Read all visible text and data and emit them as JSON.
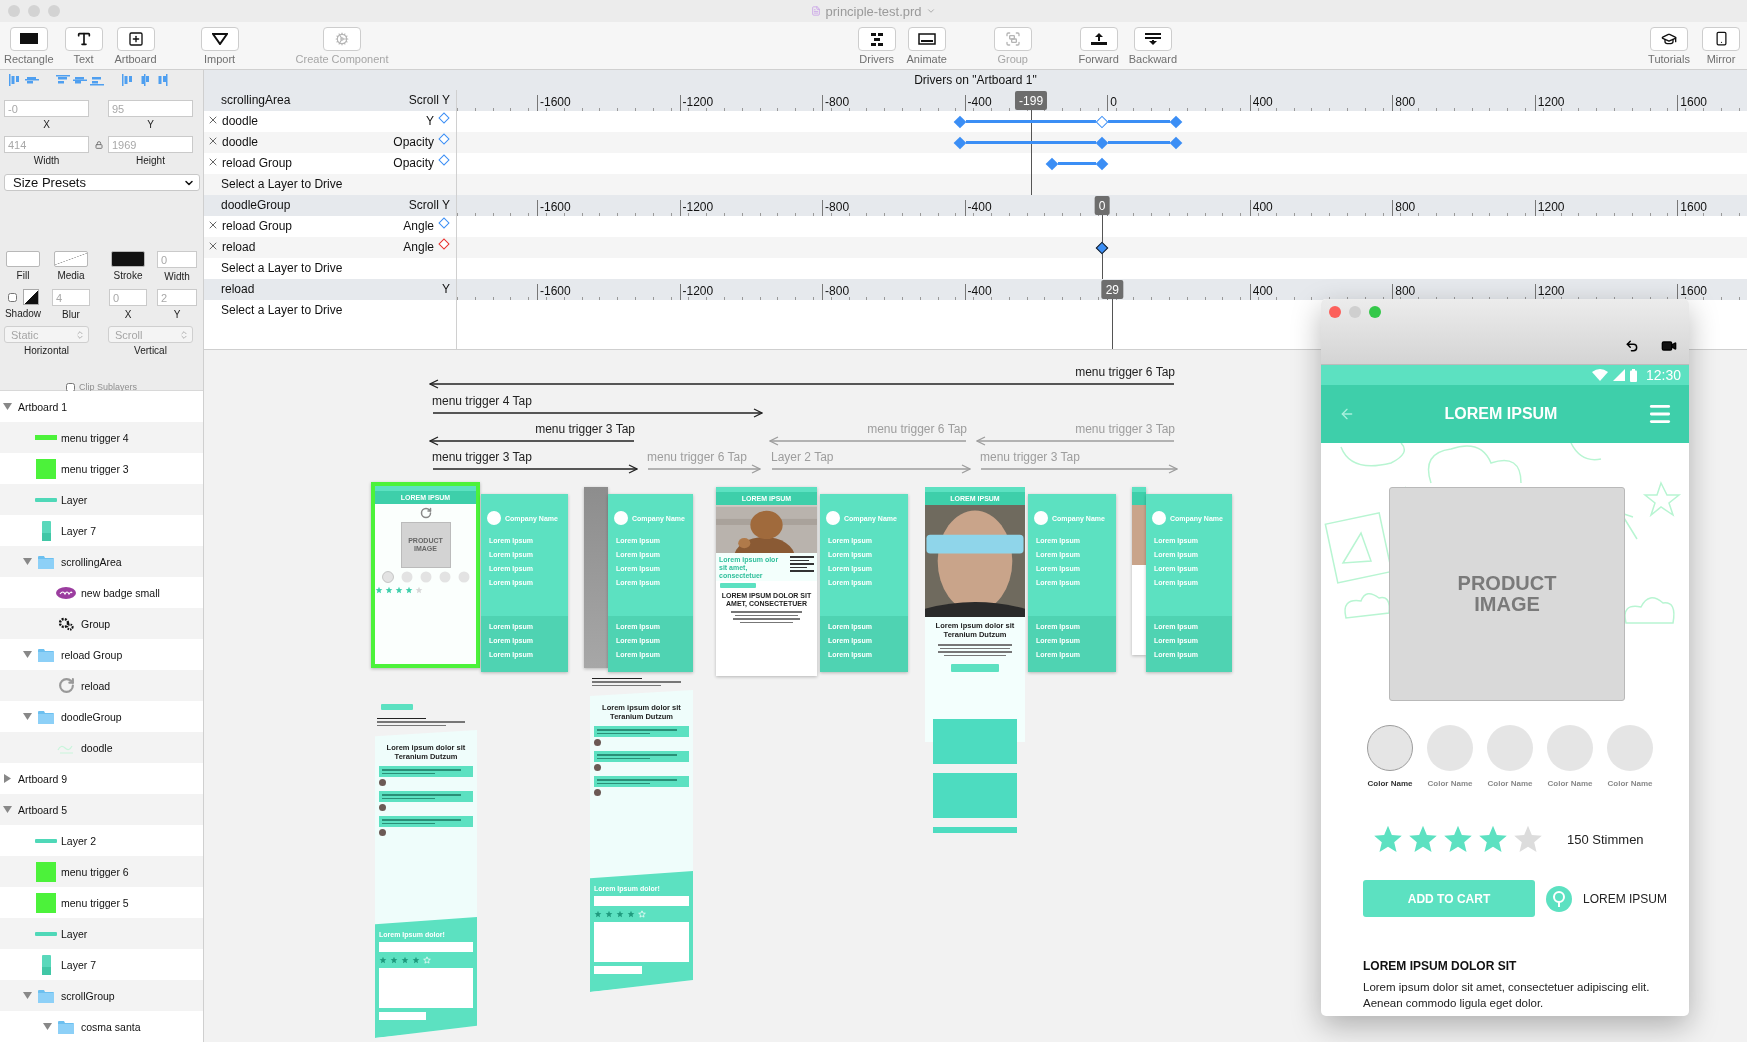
{
  "window": {
    "title": "principle-test.prd"
  },
  "toolbar": {
    "left": [
      {
        "label": "Rectangle",
        "disabled": false
      },
      {
        "label": "Text",
        "disabled": false
      },
      {
        "label": "Artboard",
        "disabled": false
      },
      {
        "label": "Import",
        "disabled": false
      },
      {
        "label": "Create Component",
        "disabled": true
      }
    ],
    "center": [
      {
        "label": "Drivers",
        "disabled": false
      },
      {
        "label": "Animate",
        "disabled": false
      },
      {
        "label": "Group",
        "disabled": true
      },
      {
        "label": "Forward",
        "disabled": false
      },
      {
        "label": "Backward",
        "disabled": false
      }
    ],
    "right": [
      {
        "label": "Tutorials",
        "disabled": false
      },
      {
        "label": "Mirror",
        "disabled": false
      }
    ]
  },
  "inspector": {
    "position": [
      {
        "label": "X",
        "value": "-0"
      },
      {
        "label": "Y",
        "value": "95"
      }
    ],
    "size": [
      {
        "label": "Width",
        "value": "414"
      },
      {
        "label": "Height",
        "value": "1969"
      }
    ],
    "size_presets": "Size Presets",
    "style": {
      "fill": "Fill",
      "media": "Media",
      "stroke": "Stroke",
      "stroke_width": {
        "label": "Width",
        "value": "0"
      }
    },
    "shadow": {
      "label": "Shadow",
      "checked": false,
      "blur": {
        "label": "Blur",
        "value": "4"
      },
      "x": {
        "label": "X",
        "value": "0"
      },
      "y": {
        "label": "Y",
        "value": "2"
      }
    },
    "scrolling": [
      {
        "label": "Horizontal",
        "value": "Static"
      },
      {
        "label": "Vertical",
        "value": "Scroll"
      }
    ],
    "clip_sublayers": {
      "label": "Clip Sublayers",
      "checked": false
    }
  },
  "layers": [
    {
      "name": "Artboard 1",
      "kind": "artboard",
      "expanded": true,
      "children": [
        {
          "name": "menu trigger 4",
          "kind": "bar"
        },
        {
          "name": "menu trigger 3",
          "kind": "square"
        },
        {
          "name": "Layer",
          "kind": "line"
        },
        {
          "name": "Layer 7",
          "kind": "phone"
        },
        {
          "name": "scrollingArea",
          "kind": "folder",
          "expanded": true,
          "children": [
            {
              "name": "new badge small",
              "kind": "badge"
            },
            {
              "name": "Group",
              "kind": "gears"
            }
          ]
        },
        {
          "name": "reload Group",
          "kind": "folder",
          "expanded": true,
          "children": [
            {
              "name": "reload",
              "kind": "reload"
            }
          ]
        },
        {
          "name": "doodleGroup",
          "kind": "folder",
          "expanded": true,
          "children": [
            {
              "name": "doodle",
              "kind": "doodle"
            }
          ]
        }
      ]
    },
    {
      "name": "Artboard 9",
      "kind": "artboard",
      "expanded": false
    },
    {
      "name": "Artboard 5",
      "kind": "artboard",
      "expanded": true,
      "children": [
        {
          "name": "Layer 2",
          "kind": "line"
        },
        {
          "name": "menu trigger 6",
          "kind": "square"
        },
        {
          "name": "menu trigger 5",
          "kind": "square"
        },
        {
          "name": "Layer",
          "kind": "line"
        },
        {
          "name": "Layer 7",
          "kind": "phone"
        },
        {
          "name": "scrollGroup",
          "kind": "folder",
          "expanded": true,
          "children": [
            {
              "name": "cosma santa",
              "kind": "folder",
              "expanded": true
            }
          ]
        }
      ]
    }
  ],
  "drivers": {
    "title": "Drivers on \"Artboard 1\"",
    "groups": [
      {
        "source": "scrollingArea",
        "property": "Scroll Y",
        "ticks": [
          "-1600",
          "-1200",
          "-800",
          "-400",
          "0",
          "400",
          "800",
          "1200",
          "1600"
        ],
        "marker": {
          "label": "-199",
          "level": 0.445
        },
        "rows": [
          {
            "layer": "doodle",
            "property": "Y",
            "color": "#3b8ef5",
            "keyframes": [
              {
                "level": 0.39,
                "kind": "filled"
              },
              {
                "level": 0.5,
                "kind": "hollow"
              },
              {
                "level": 0.557,
                "kind": "filled"
              }
            ]
          },
          {
            "layer": "doodle",
            "property": "Opacity",
            "color": "#3b8ef5",
            "keyframes": [
              {
                "level": 0.39,
                "kind": "filled"
              },
              {
                "level": 0.5,
                "kind": "filled"
              },
              {
                "level": 0.557,
                "kind": "filled"
              }
            ]
          },
          {
            "layer": "reload Group",
            "property": "Opacity",
            "color": "#3b8ef5",
            "keyframes": [
              {
                "level": 0.461,
                "kind": "filled"
              },
              {
                "level": 0.5,
                "kind": "filled"
              }
            ]
          }
        ],
        "empty": "Select a Layer to Drive"
      },
      {
        "source": "doodleGroup",
        "property": "Scroll Y",
        "ticks": [
          "-1600",
          "-1200",
          "-800",
          "-400",
          "400",
          "800",
          "1200",
          "1600"
        ],
        "marker": {
          "label": "0",
          "level": 0.5
        },
        "rows": [
          {
            "layer": "reload Group",
            "property": "Angle",
            "color": "#3b8ef5"
          },
          {
            "layer": "reload",
            "property": "Angle",
            "color": "#e8322e",
            "keyframes": [
              {
                "level": 0.5,
                "kind": "selected"
              }
            ]
          }
        ],
        "empty": "Select a Layer to Drive"
      },
      {
        "source": "reload",
        "property": "Y",
        "ticks": [
          "-1600",
          "-1200",
          "-800",
          "-400",
          "400",
          "800",
          "1200",
          "1600"
        ],
        "marker": {
          "label": "29",
          "level": 0.508
        },
        "empty": "Select a Layer to Drive"
      }
    ]
  },
  "canvas": {
    "flows": [
      {
        "label": "menu trigger 6 Tap",
        "backward": true,
        "active": true
      },
      {
        "label": "menu trigger 4 Tap",
        "backward": false,
        "active": true
      },
      {
        "label": "menu trigger 3 Tap",
        "backward": true,
        "active": true
      },
      {
        "label": "menu trigger 6 Tap",
        "backward": true,
        "active": false
      },
      {
        "label": "menu trigger 3 Tap",
        "backward": true,
        "active": false
      },
      {
        "label": "menu trigger 3 Tap",
        "backward": false,
        "active": true
      },
      {
        "label": "menu trigger 6 Tap",
        "backward": false,
        "active": false
      },
      {
        "label": "Layer 2 Tap",
        "backward": false,
        "active": false
      },
      {
        "label": "menu trigger 3 Tap",
        "backward": false,
        "active": false
      }
    ],
    "artboards": [
      {
        "kind": "product",
        "selected": true,
        "title": "LOREM IPSUM",
        "image": "PRODUCT IMAGE",
        "stars": 4
      },
      {
        "kind": "menu",
        "selected": false,
        "company": "Company Name",
        "items": [
          "Lorem Ipsum",
          "Lorem Ipsum",
          "Lorem Ipsum",
          "Lorem Ipsum"
        ],
        "footer_items": [
          "Lorem Ipsum",
          "Lorem Ipsum",
          "Lorem Ipsum"
        ]
      },
      {
        "kind": "dimmed",
        "selected": false
      },
      {
        "kind": "menu",
        "selected": false,
        "company": "Company Name",
        "items": [
          "Lorem Ipsum",
          "Lorem Ipsum",
          "Lorem Ipsum",
          "Lorem Ipsum"
        ],
        "footer_items": [
          "Lorem Ipsum",
          "Lorem Ipsum",
          "Lorem Ipsum"
        ]
      },
      {
        "kind": "promo",
        "selected": false,
        "title": "LOREM IPSUM",
        "headline": "Lorem ipsum olor sit amet, consectetuer",
        "heading": "LOREM IPSUM DOLOR SIT AMET, CONSECTETUER"
      },
      {
        "kind": "menu",
        "selected": false,
        "company": "Company Name",
        "items": [
          "Lorem Ipsum",
          "Lorem Ipsum",
          "Lorem Ipsum",
          "Lorem Ipsum"
        ],
        "footer_items": [
          "Lorem Ipsum",
          "Lorem Ipsum",
          "Lorem Ipsum"
        ]
      },
      {
        "kind": "selfie",
        "selected": false,
        "title": "LOREM IPSUM",
        "heading": "Lorem ipsum dolor sit Teranium Dutzum"
      },
      {
        "kind": "menu",
        "selected": false,
        "company": "Company Name",
        "items": [
          "Lorem Ipsum",
          "Lorem Ipsum",
          "Lorem Ipsum",
          "Lorem Ipsum"
        ],
        "footer_items": [
          "Lorem Ipsum",
          "Lorem Ipsum",
          "Lorem Ipsum"
        ]
      },
      {
        "kind": "partial",
        "selected": false
      },
      {
        "kind": "menu",
        "selected": false,
        "company": "Company Name",
        "items": [
          "Lorem Ipsum",
          "Lorem Ipsum",
          "Lorem Ipsum",
          "Lorem Ipsum"
        ],
        "footer_items": [
          "Lorem Ipsum",
          "Lorem Ipsum",
          "Lorem Ipsum"
        ]
      },
      {
        "kind": "feed",
        "selected": false,
        "heading": "Lorem ipsum dolor sit Teranium Dutzum",
        "form_title": "Lorem Ipsum dolor!",
        "stars": 4
      },
      {
        "kind": "feed",
        "selected": false,
        "heading": "Lorem ipsum dolor sit Teranium Dutzum",
        "form_title": "Lorem Ipsum dolor!",
        "stars": 4
      }
    ]
  },
  "preview": {
    "status_time": "12:30",
    "app_title": "LOREM IPSUM",
    "product_image": "PRODUCT IMAGE",
    "swatches": [
      {
        "label": "Color Name",
        "selected": true
      },
      {
        "label": "Color Name",
        "selected": false
      },
      {
        "label": "Color Name",
        "selected": false
      },
      {
        "label": "Color Name",
        "selected": false
      },
      {
        "label": "Color Name",
        "selected": false
      }
    ],
    "rating": {
      "stars": 4,
      "votes": "150 Stimmen"
    },
    "add_to_cart": "ADD TO CART",
    "location": "LOREM IPSUM",
    "heading": "LOREM IPSUM DOLOR SIT",
    "body": "Lorem ipsum dolor sit amet, consectetuer adipiscing elit. Aenean commodo ligula eget dolor."
  }
}
